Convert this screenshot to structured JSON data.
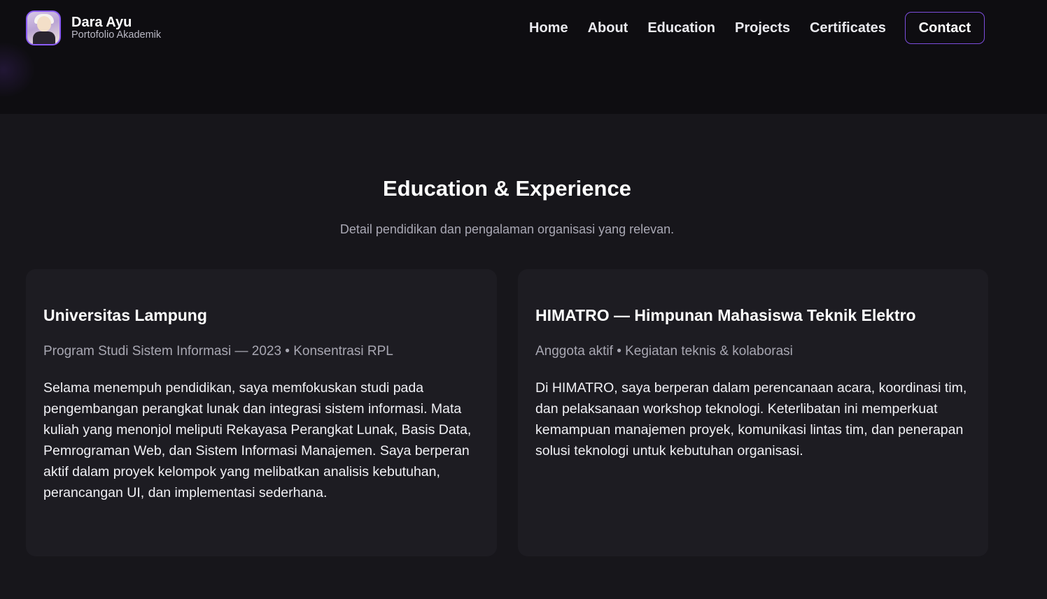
{
  "brand": {
    "name": "Dara Ayu",
    "subtitle": "Portofolio Akademik"
  },
  "nav": {
    "links": [
      "Home",
      "About",
      "Education",
      "Projects",
      "Certificates"
    ],
    "contact": "Contact"
  },
  "colors": {
    "accent": "#7c4ddc",
    "background": "#17161b",
    "header_background": "#0e0d11",
    "card_background": "#1d1c22"
  },
  "section": {
    "title": "Education & Experience",
    "subtitle": "Detail pendidikan dan pengalaman organisasi yang relevan."
  },
  "cards": [
    {
      "title": "Universitas Lampung",
      "meta": "Program Studi Sistem Informasi — 2023 • Konsentrasi RPL",
      "body": "Selama menempuh pendidikan, saya memfokuskan studi pada pengembangan perangkat lunak dan integrasi sistem informasi. Mata kuliah yang menonjol meliputi Rekayasa Perangkat Lunak, Basis Data, Pemrograman Web, dan Sistem Informasi Manajemen. Saya berperan aktif dalam proyek kelompok yang melibatkan analisis kebutuhan, perancangan UI, dan implementasi sederhana."
    },
    {
      "title": "HIMATRO — Himpunan Mahasiswa Teknik Elektro",
      "meta": "Anggota aktif • Kegiatan teknis & kolaborasi",
      "body": "Di HIMATRO, saya berperan dalam perencanaan acara, koordinasi tim, dan pelaksanaan workshop teknologi. Keterlibatan ini memperkuat kemampuan manajemen proyek, komunikasi lintas tim, dan penerapan solusi teknologi untuk kebutuhan organisasi."
    }
  ]
}
